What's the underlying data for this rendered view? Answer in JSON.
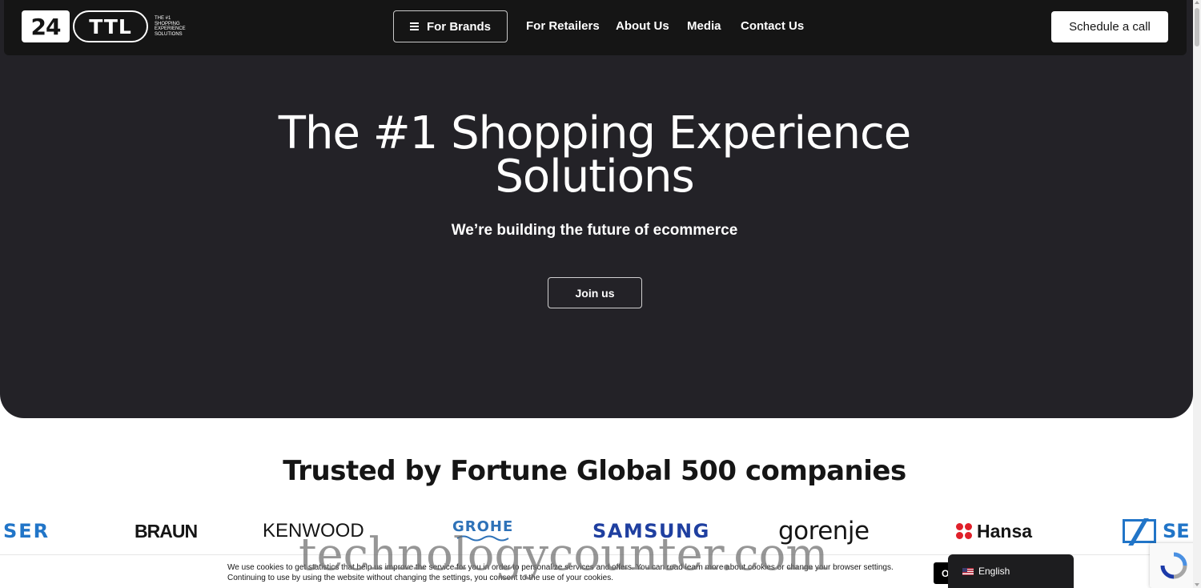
{
  "logo": {
    "mark_24": "24",
    "mark_ttl": "TTL",
    "tagline": "THE #1 SHOPPING EXPERIENCE SOLUTIONS"
  },
  "nav": {
    "for_brands": "For Brands",
    "for_retailers": "For Retailers",
    "about_us": "About Us",
    "media": "Media",
    "contact_us": "Contact Us",
    "schedule_call": "Schedule a call"
  },
  "hero": {
    "title_line1": "The #1 Shopping Experience",
    "title_line2": "Solutions",
    "subtitle": "We’re building the future of ecommerce",
    "cta": "Join us"
  },
  "trusted": {
    "title": "Trusted by Fortune Global 500 companies",
    "brands": [
      "SER",
      "BRAUN",
      "KENWOOD",
      "GROHE",
      "SAMSUNG",
      "gorenje",
      "Hansa",
      "SE"
    ]
  },
  "cookie": {
    "text": "We use cookies to get statistics that help us improve the service for you in order to personalize services and offers. You can read learn more about cookies or change your browser settings. Continuing to use by using the website without changing the settings, you consent to the use of your cookies.",
    "ok_label": "O"
  },
  "language": {
    "label": "English",
    "flag": "us-flag-icon"
  },
  "watermark": "technologycounter.com",
  "colors": {
    "hero_bg": "#232227",
    "nav_bg": "#151515",
    "samsung_blue": "#1f3fa0",
    "hansa_red": "#e0202a",
    "sennheiser_blue": "#2175c8"
  }
}
